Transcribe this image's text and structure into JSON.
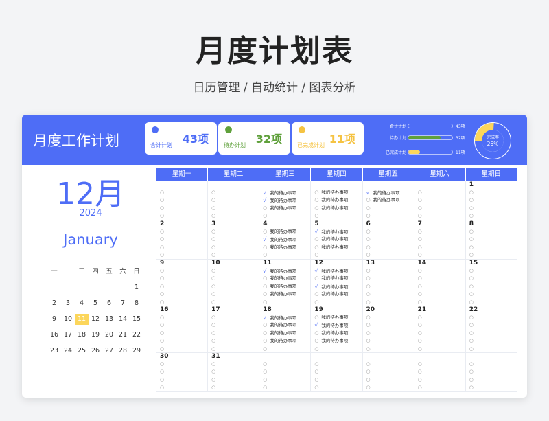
{
  "hero": {
    "title": "月度计划表",
    "subtitle": "日历管理 / 自动统计 / 图表分析"
  },
  "app": {
    "title": "月度工作计划"
  },
  "stats": [
    {
      "label": "合计计划",
      "value": "43项",
      "color": "#4e6df6"
    },
    {
      "label": "待办计划",
      "value": "32项",
      "color": "#5fa03b"
    },
    {
      "label": "已完成计划",
      "value": "11项",
      "color": "#f5c342"
    }
  ],
  "bars": [
    {
      "label": "合计计划",
      "value": "43项",
      "fraction": 1.0,
      "color": "#4e6df6"
    },
    {
      "label": "待办计划",
      "value": "32项",
      "fraction": 0.74,
      "color": "#5fa03b"
    },
    {
      "label": "已完成计划",
      "value": "11项",
      "fraction": 0.26,
      "color": "#fcd65b"
    }
  ],
  "donut": {
    "label": "完成率",
    "percent": "26%",
    "fraction": 0.26,
    "color_done": "#fcd65b",
    "color_rest": "#4e6df6"
  },
  "side": {
    "month": "12月",
    "year": "2024",
    "english": "January"
  },
  "mini": {
    "weekdays": [
      "一",
      "二",
      "三",
      "四",
      "五",
      "六",
      "日"
    ],
    "weeks": [
      [
        "",
        "",
        "",
        "",
        "",
        "",
        "1"
      ],
      [
        "2",
        "3",
        "4",
        "5",
        "6",
        "7",
        "8"
      ],
      [
        "9",
        "10",
        "11",
        "12",
        "13",
        "14",
        "15"
      ],
      [
        "16",
        "17",
        "18",
        "19",
        "20",
        "21",
        "22"
      ],
      [
        "23",
        "24",
        "25",
        "26",
        "27",
        "28",
        "29"
      ]
    ],
    "highlight": "11"
  },
  "calendar": {
    "headers": [
      "星期一",
      "星期二",
      "星期三",
      "星期四",
      "星期五",
      "星期六",
      "星期日"
    ],
    "task_text": "我的待办事项",
    "weeks": [
      {
        "height": 57,
        "days": [
          {
            "day": "",
            "tasks": [
              "o",
              "o",
              "o",
              "o"
            ]
          },
          {
            "day": "",
            "tasks": [
              "o",
              "o",
              "o",
              "o"
            ]
          },
          {
            "day": "",
            "tasks": [
              "v",
              "v",
              "o",
              "o"
            ]
          },
          {
            "day": "",
            "tasks": [
              "o",
              "o",
              "o",
              "o"
            ]
          },
          {
            "day": "",
            "tasks": [
              "v",
              "o",
              "o",
              "o"
            ]
          },
          {
            "day": "",
            "tasks": [
              "o",
              "o",
              "o",
              "o"
            ]
          },
          {
            "day": "1",
            "tasks": [
              "o",
              "o",
              "o",
              "o"
            ]
          }
        ]
      },
      {
        "height": 57,
        "days": [
          {
            "day": "2",
            "tasks": [
              "o",
              "o",
              "o",
              "o"
            ]
          },
          {
            "day": "3",
            "tasks": [
              "o",
              "o",
              "o",
              "o"
            ]
          },
          {
            "day": "4",
            "tasks": [
              "o",
              "v",
              "o",
              "o"
            ]
          },
          {
            "day": "5",
            "tasks": [
              "v",
              "o",
              "o",
              "o"
            ]
          },
          {
            "day": "6",
            "tasks": [
              "o",
              "o",
              "o",
              "o"
            ]
          },
          {
            "day": "7",
            "tasks": [
              "o",
              "o",
              "o",
              "o"
            ]
          },
          {
            "day": "8",
            "tasks": [
              "o",
              "o",
              "o",
              "o"
            ]
          }
        ]
      },
      {
        "height": 68,
        "days": [
          {
            "day": "9",
            "tasks": [
              "o",
              "o",
              "o",
              "o",
              "o"
            ]
          },
          {
            "day": "10",
            "tasks": [
              "o",
              "o",
              "o",
              "o",
              "o"
            ]
          },
          {
            "day": "11",
            "tasks": [
              "v",
              "o",
              "o",
              "o",
              "o"
            ]
          },
          {
            "day": "12",
            "tasks": [
              "v",
              "o",
              "v",
              "o",
              "o"
            ]
          },
          {
            "day": "13",
            "tasks": [
              "o",
              "o",
              "o",
              "o",
              "o"
            ]
          },
          {
            "day": "14",
            "tasks": [
              "o",
              "o",
              "o",
              "o",
              "o"
            ]
          },
          {
            "day": "15",
            "tasks": [
              "o",
              "o",
              "o",
              "o",
              "o"
            ]
          }
        ]
      },
      {
        "height": 68,
        "days": [
          {
            "day": "16",
            "tasks": [
              "o",
              "o",
              "o",
              "o",
              "o"
            ]
          },
          {
            "day": "17",
            "tasks": [
              "o",
              "o",
              "o",
              "o",
              "o"
            ]
          },
          {
            "day": "18",
            "tasks": [
              "v",
              "o",
              "o",
              "o",
              "o"
            ]
          },
          {
            "day": "19",
            "tasks": [
              "o",
              "v",
              "o",
              "o",
              "o"
            ]
          },
          {
            "day": "20",
            "tasks": [
              "o",
              "o",
              "o",
              "o",
              "o"
            ]
          },
          {
            "day": "21",
            "tasks": [
              "o",
              "o",
              "o",
              "o",
              "o"
            ]
          },
          {
            "day": "22",
            "tasks": [
              "o",
              "o",
              "o",
              "o",
              "o"
            ]
          }
        ]
      },
      {
        "height": 57,
        "days": [
          {
            "day": "30",
            "tasks": [
              "o",
              "o",
              "o",
              "o"
            ]
          },
          {
            "day": "31",
            "tasks": [
              "o",
              "o",
              "o",
              "o"
            ]
          },
          {
            "day": "",
            "tasks": [
              "o",
              "o",
              "o",
              "o"
            ]
          },
          {
            "day": "",
            "tasks": [
              "o",
              "o",
              "o",
              "o"
            ]
          },
          {
            "day": "",
            "tasks": [
              "o",
              "o",
              "o",
              "o"
            ]
          },
          {
            "day": "",
            "tasks": [
              "o",
              "o",
              "o",
              "o"
            ]
          },
          {
            "day": "",
            "tasks": [
              "o",
              "o",
              "o",
              "o"
            ]
          }
        ]
      }
    ]
  }
}
